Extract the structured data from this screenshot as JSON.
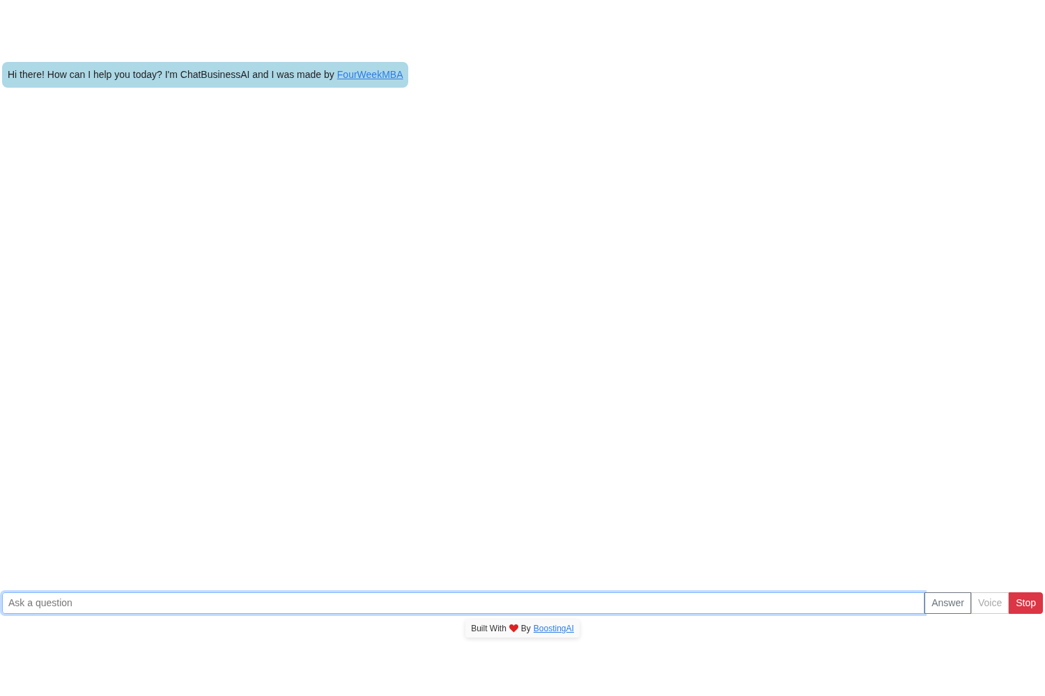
{
  "messages": [
    {
      "text": "Hi there! How can I help you today? I'm ChatBusinessAI and I was made by",
      "link": "FourWeekMBA"
    }
  ],
  "composer": {
    "placeholder": "Ask a question",
    "focused": true
  },
  "buttons": [
    {
      "label": "Answer",
      "kind": "outline",
      "disabled": false
    },
    {
      "label": "Voice",
      "kind": "outline",
      "disabled": true
    },
    {
      "label": "Stop",
      "kind": "danger",
      "disabled": false
    }
  ],
  "footer": {
    "before": "Built With",
    "after": "By",
    "link": "BoostingAI"
  }
}
